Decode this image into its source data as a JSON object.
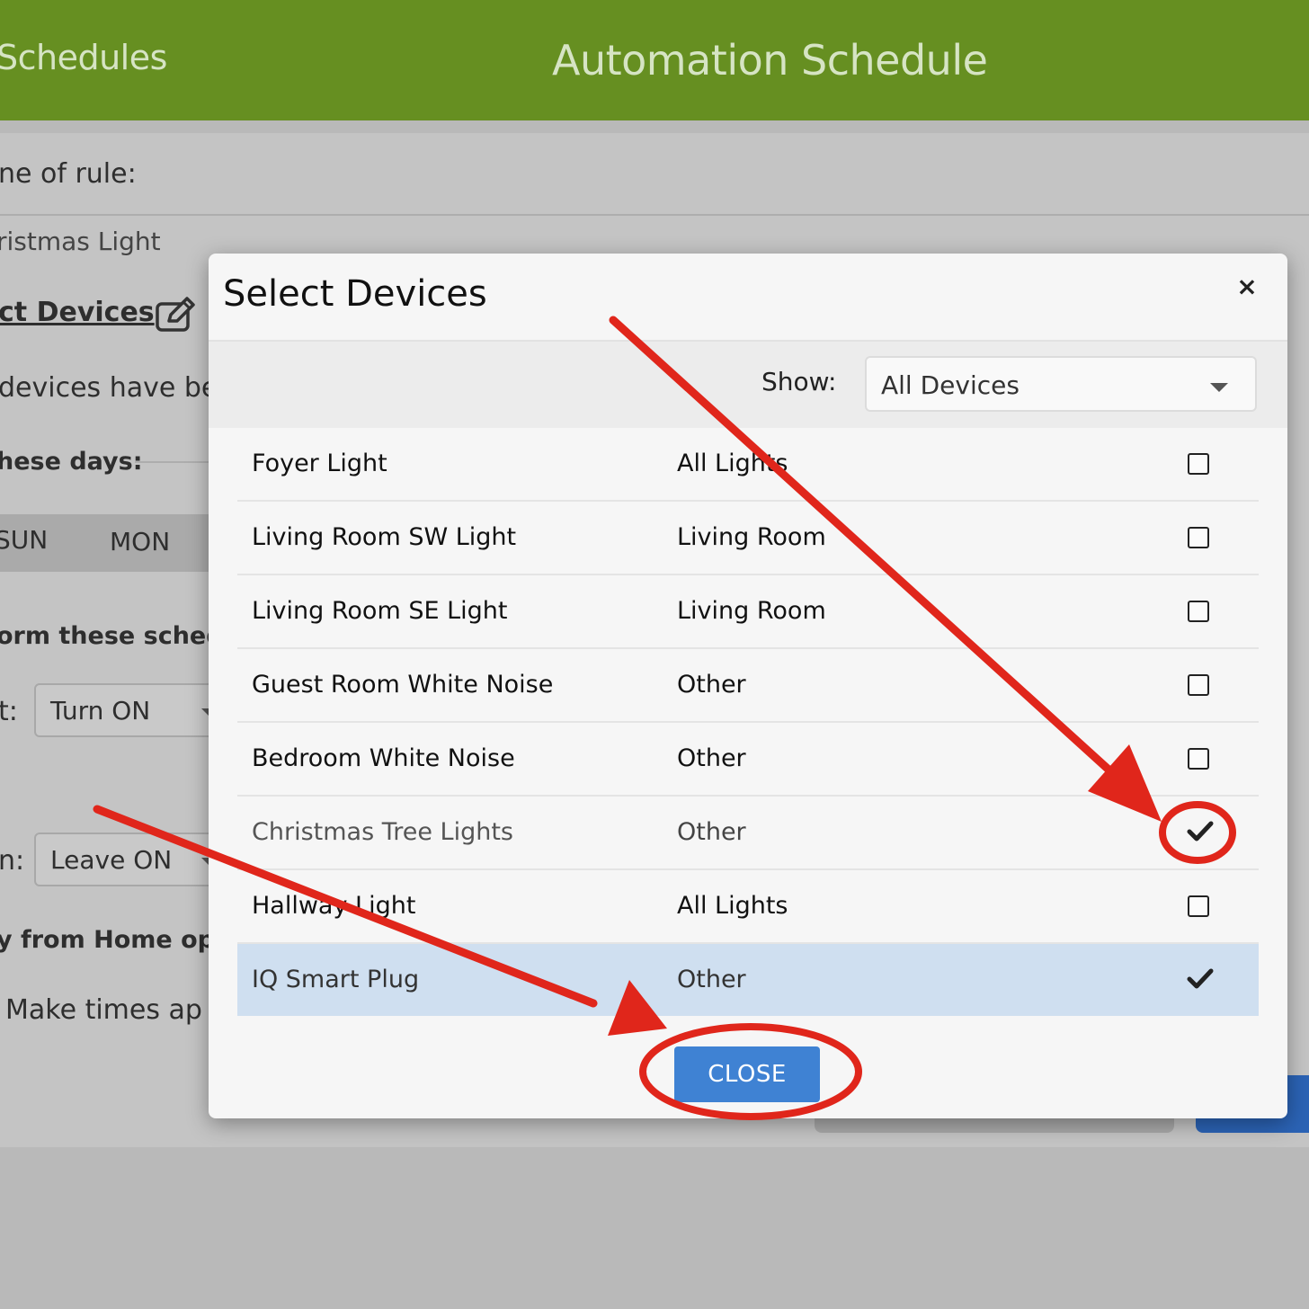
{
  "header": {
    "back_label": "Schedules",
    "title": "Automation Schedule",
    "color": "#668f21"
  },
  "background": {
    "rule_name_label": "ne of rule:",
    "rule_name_value": "ristmas Light",
    "select_devices_link": "ct Devices",
    "devices_note": "devices have bee",
    "days_label": "hese days:",
    "day_sun": "SUN",
    "day_mon": "MON",
    "perform_label": "orm these schedul",
    "start_label": "t:",
    "start_action": "Turn ON",
    "end_label": "n:",
    "end_action": "Leave ON",
    "away_label": "y from Home opti",
    "make_times_label": "Make times ap"
  },
  "modal": {
    "title": "Select Devices",
    "close_icon": "×",
    "show_label": "Show:",
    "show_value": "All Devices",
    "devices": [
      {
        "name": "Foyer Light",
        "group": "All Lights",
        "checked": false
      },
      {
        "name": "Living Room SW Light",
        "group": "Living Room",
        "checked": false
      },
      {
        "name": "Living Room SE Light",
        "group": "Living Room",
        "checked": false
      },
      {
        "name": "Guest Room White Noise",
        "group": "Other",
        "checked": false
      },
      {
        "name": "Bedroom White Noise",
        "group": "Other",
        "checked": false
      },
      {
        "name": "Christmas Tree Lights",
        "group": "Other",
        "checked": true
      },
      {
        "name": "Hallway Light",
        "group": "All Lights",
        "checked": false
      },
      {
        "name": "IQ Smart Plug",
        "group": "Other",
        "checked": true
      }
    ],
    "close_button": "CLOSE",
    "close_button_color": "#3f82d3"
  },
  "annotation_color": "#e0261b"
}
